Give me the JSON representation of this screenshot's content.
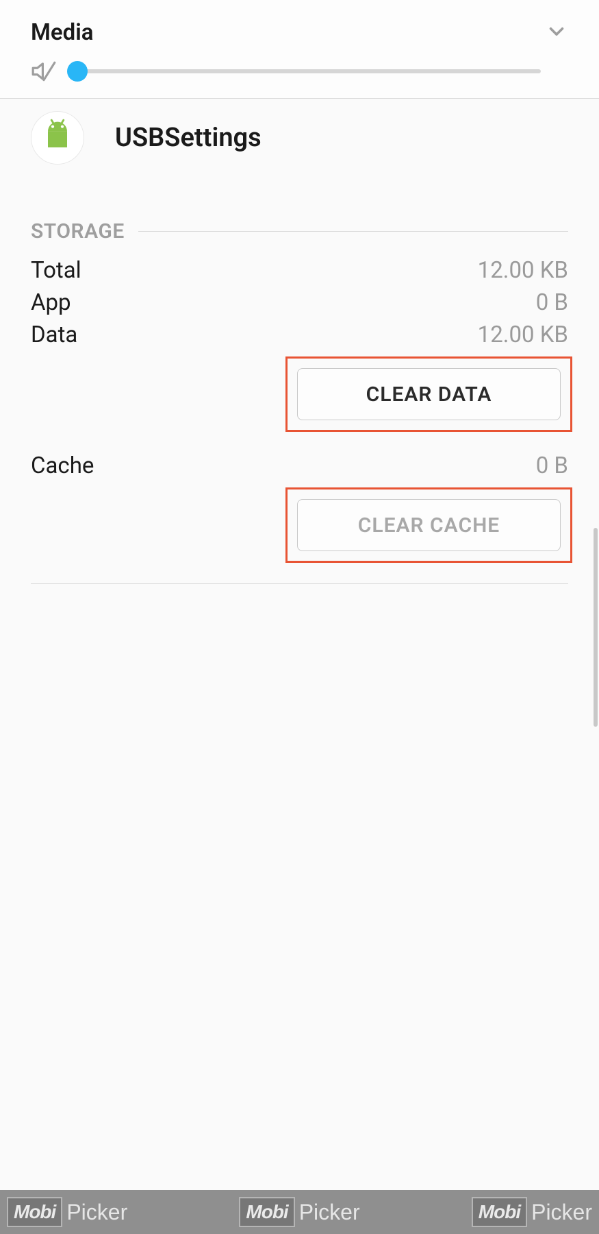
{
  "volume": {
    "title": "Media",
    "muted_icon": "volume-mute-icon",
    "level": 0
  },
  "app": {
    "name": "USBSettings",
    "icon": "android-icon"
  },
  "storage": {
    "section_title": "STORAGE",
    "rows": [
      {
        "label": "Total",
        "value": "12.00 KB"
      },
      {
        "label": "App",
        "value": "0 B"
      },
      {
        "label": "Data",
        "value": "12.00 KB"
      }
    ],
    "clear_data_label": "CLEAR DATA",
    "cache_label": "Cache",
    "cache_value": "0 B",
    "clear_cache_label": "CLEAR CACHE"
  },
  "watermark": {
    "mobi": "Mobi",
    "picker": "Picker"
  }
}
